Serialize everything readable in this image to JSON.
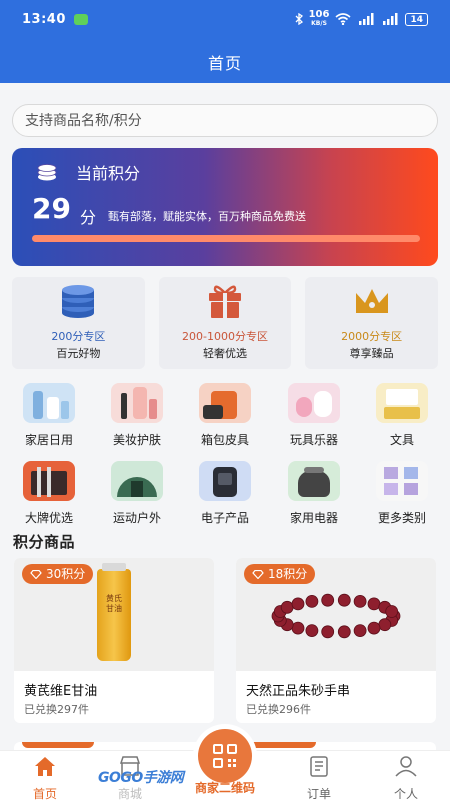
{
  "status_bar": {
    "time": "13:40",
    "speed": "106",
    "speed_unit": "KB/S",
    "battery": "14"
  },
  "header": {
    "title": "首页"
  },
  "search": {
    "placeholder": "支持商品名称/积分"
  },
  "points": {
    "label": "当前积分",
    "value": "29",
    "unit": "分",
    "slogan": "甄有部落，赋能实体，百万种商品免费送"
  },
  "zones": [
    {
      "range": "200分专区",
      "name": "百元好物",
      "color": "#2f5fb8",
      "icon": "coins-icon"
    },
    {
      "range": "200-1000分专区",
      "name": "轻奢优选",
      "color": "#c9563a",
      "icon": "gift-icon"
    },
    {
      "range": "2000分专区",
      "name": "尊享臻品",
      "color": "#c98a1a",
      "icon": "crown-icon"
    }
  ],
  "categories": [
    {
      "name": "家居日用"
    },
    {
      "name": "美妆护肤"
    },
    {
      "name": "箱包皮具"
    },
    {
      "name": "玩具乐器"
    },
    {
      "name": "文具"
    },
    {
      "name": "大牌优选"
    },
    {
      "name": "运动户外"
    },
    {
      "name": "电子产品"
    },
    {
      "name": "家用电器"
    },
    {
      "name": "更多类别"
    }
  ],
  "section": {
    "title": "积分商品"
  },
  "products": [
    {
      "points": "30积分",
      "name": "黄芪维E甘油",
      "sold": "已兑换297件",
      "label_text": "黄氏甘油"
    },
    {
      "points": "18积分",
      "name": "天然正品朱砂手串",
      "sold": "已兑换296件"
    }
  ],
  "tabbar": {
    "home": "首页",
    "mall": "商城",
    "qr": "商家二维码",
    "orders": "订单",
    "profile": "个人"
  },
  "watermark": "GOGO手游网",
  "colors": {
    "primary": "#2f6fde",
    "accent": "#e46a2a"
  }
}
